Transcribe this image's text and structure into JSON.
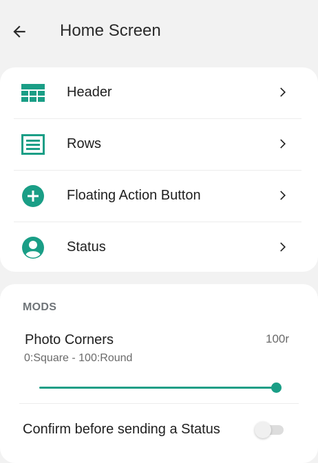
{
  "app_bar": {
    "title": "Home Screen",
    "back_icon": "arrow-back-icon"
  },
  "nav_items": [
    {
      "label": "Header",
      "icon": "header-grid-icon"
    },
    {
      "label": "Rows",
      "icon": "rows-list-icon"
    },
    {
      "label": "Floating Action Button",
      "icon": "add-circle-icon"
    },
    {
      "label": "Status",
      "icon": "account-circle-icon"
    }
  ],
  "mods": {
    "section_title": "MODS",
    "photo_corners": {
      "title": "Photo Corners",
      "value": "100r",
      "subtitle": "0:Square - 100:Round",
      "slider_value": 100,
      "slider_min": 0,
      "slider_max": 100
    },
    "confirm_status": {
      "label": "Confirm before sending a Status",
      "enabled": false
    }
  },
  "colors": {
    "accent": "#1a9e86",
    "background": "#f2f2f2",
    "card": "#ffffff",
    "text_primary": "#1f1f1f",
    "text_secondary": "#6a6a6a",
    "section_header": "#6f7478"
  }
}
